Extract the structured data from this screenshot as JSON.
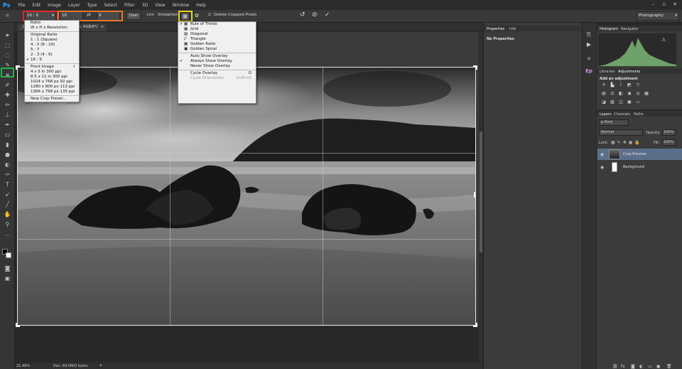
{
  "app": {
    "logo": "Ps",
    "menus": [
      "File",
      "Edit",
      "Image",
      "Layer",
      "Type",
      "Select",
      "Filter",
      "3D",
      "View",
      "Window",
      "Help"
    ],
    "window_buttons": [
      "–",
      "▫",
      "✕"
    ]
  },
  "options_bar": {
    "ratio_value": "16 : 9",
    "width_value": "16",
    "swap_icon": "⇄",
    "height_value": "9",
    "clear_label": "Clear",
    "straighten_icon": "Lhn",
    "straighten_label": "Straighten",
    "delete_cropped_label": "Delete Cropped Pixels",
    "workspace_value": "Photography",
    "highlight_colors": {
      "ratio": "#e0262c",
      "fields": "#e8762a",
      "overlay": "#e6d21c",
      "tool": "#27b34a"
    }
  },
  "document": {
    "tab_label": "_DS",
    "tab2_label": "w, RGB/8*)",
    "tab2_close": "×",
    "zoom": "21.49%",
    "doc_info": "Doc: 69.0M/0 bytes"
  },
  "ratio_menu": {
    "items": [
      {
        "label": "Ratio",
        "checked": false,
        "disabled": false
      },
      {
        "label": "W x H x Resolution",
        "checked": false,
        "disabled": false
      },
      {
        "sep": true
      },
      {
        "label": "Original Ratio",
        "checked": false,
        "disabled": false
      },
      {
        "label": "1 : 1 (Square)",
        "checked": false,
        "disabled": false
      },
      {
        "label": "4 : 5 (8 : 10)",
        "checked": false,
        "disabled": false
      },
      {
        "label": "5 : 7",
        "checked": false,
        "disabled": false
      },
      {
        "label": "2 : 3 (4 : 6)",
        "checked": false,
        "disabled": false
      },
      {
        "label": "16 : 9",
        "checked": true,
        "disabled": false
      },
      {
        "sep": true
      },
      {
        "label": "Front Image",
        "checked": false,
        "disabled": false,
        "shortcut": "I"
      },
      {
        "label": "4 x 5 in 300 ppi",
        "checked": false,
        "disabled": false
      },
      {
        "label": "8.5 x 11 in 300 ppi",
        "checked": false,
        "disabled": false
      },
      {
        "label": "1024 x 768 px 92 ppi",
        "checked": false,
        "disabled": false
      },
      {
        "label": "1280 x 800 px 113 ppi",
        "checked": false,
        "disabled": false
      },
      {
        "label": "1366 x 768 px 135 ppi",
        "checked": false,
        "disabled": false
      },
      {
        "sep": true
      },
      {
        "label": "New Crop Preset...",
        "checked": false,
        "disabled": false
      },
      {
        "label": "Delete Crop Preset...",
        "checked": false,
        "disabled": true
      }
    ]
  },
  "overlay_menu": {
    "items": [
      {
        "label": "Rule of Thirds",
        "checked": true,
        "icon": "▦"
      },
      {
        "label": "Grid",
        "checked": false,
        "icon": "▦"
      },
      {
        "label": "Diagonal",
        "checked": false,
        "icon": "▨"
      },
      {
        "label": "Triangle",
        "checked": false,
        "icon": "◸"
      },
      {
        "label": "Golden Ratio",
        "checked": false,
        "icon": "▦"
      },
      {
        "label": "Golden Spiral",
        "checked": false,
        "icon": "▣"
      },
      {
        "sep": true
      },
      {
        "label": "Auto Show Overlay",
        "checked": false
      },
      {
        "label": "Always Show Overlay",
        "checked": true
      },
      {
        "label": "Never Show Overlay",
        "checked": false
      },
      {
        "sep": true
      },
      {
        "label": "Cycle Overlay",
        "checked": false,
        "shortcut": "O"
      },
      {
        "label": "Cycle Orientation",
        "checked": false,
        "shortcut": "Shift+O",
        "disabled": true
      }
    ]
  },
  "properties_panel": {
    "tabs": [
      "Properties",
      "Info"
    ],
    "content": "No Properties"
  },
  "histogram_panel": {
    "tabs": [
      "Histogram",
      "Navigator"
    ],
    "warning": "⚠"
  },
  "adjustments_panel": {
    "tabs": [
      "Libraries",
      "Adjustments"
    ],
    "title": "Add an adjustment"
  },
  "layers_panel": {
    "tabs": [
      "Layers",
      "Channels",
      "Paths"
    ],
    "kind_label": "ρ Kind",
    "blend_mode": "Normal",
    "opacity_label": "Opacity:",
    "opacity_value": "100%",
    "lock_label": "Lock:",
    "fill_label": "Fill:",
    "fill_value": "100%",
    "layers": [
      {
        "name": "Crop Preview",
        "selected": true
      },
      {
        "name": "Background",
        "selected": false
      }
    ]
  }
}
